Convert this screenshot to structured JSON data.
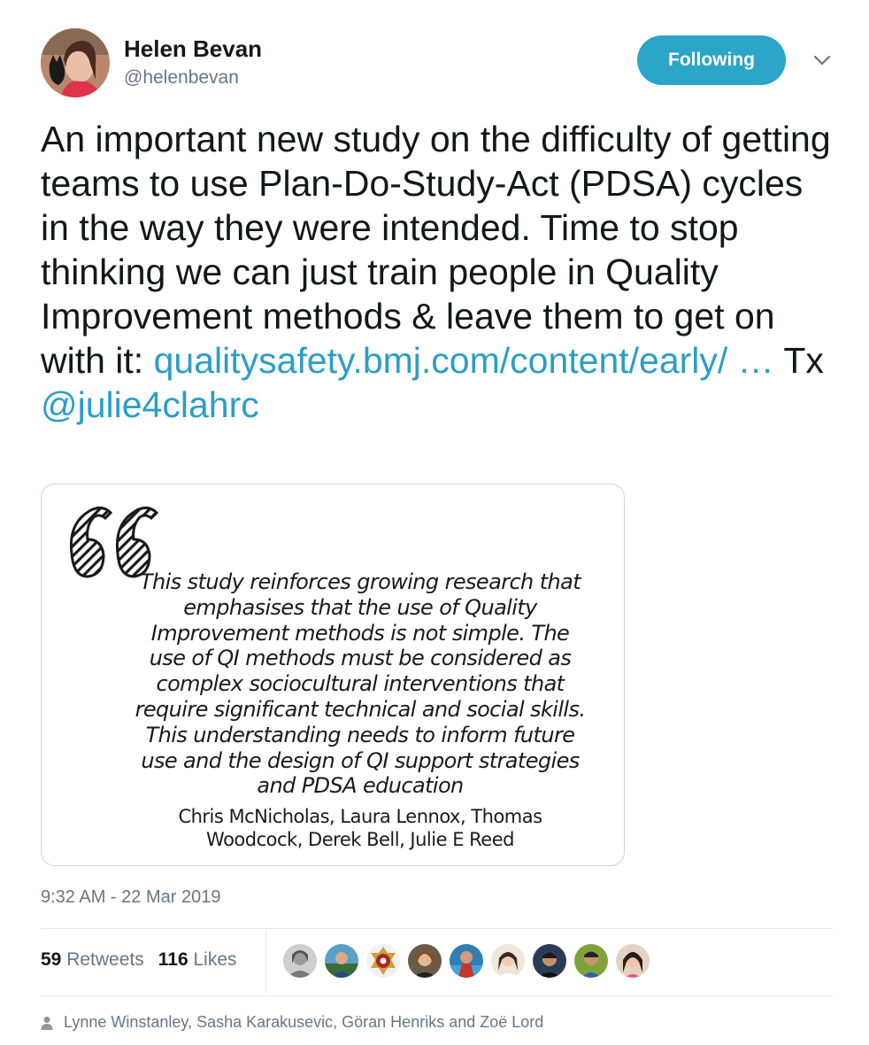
{
  "author": {
    "name": "Helen Bevan",
    "handle": "@helenbevan",
    "avatar_icon": "profile-photo-avatar"
  },
  "follow_button": {
    "label": "Following",
    "color": "#2ba5c8"
  },
  "menu_icon": "chevron-down-icon",
  "tweet": {
    "text_main": "An important new study on the difficulty of getting teams to use Plan-Do-Study-Act (PDSA) cycles in the way they were intended. Time to stop thinking we can just train people in Quality Improvement methods & leave them to get on with it: ",
    "link": "qualitysafety.bmj.com/content/early/ …",
    "text_after_link": " Tx ",
    "mention": "@julie4clahrc",
    "link_color": "#2b9ec6"
  },
  "card": {
    "quote_icon": "quotation-mark-icon",
    "quote": "This study reinforces growing research that emphasises that the use of Quality Improvement methods is not simple. The use of QI methods must be considered as complex sociocultural interventions that require significant technical and social skills. This understanding needs to inform future use and the design of QI support strategies and PDSA education",
    "authors": "Chris McNicholas, Laura Lennox, Thomas Woodcock, Derek Bell, Julie E Reed"
  },
  "timestamp": "9:32 AM - 22 Mar 2019",
  "stats": {
    "retweets_count": "59",
    "retweets_label": "Retweets",
    "likes_count": "116",
    "likes_label": "Likes"
  },
  "likers": [
    {
      "icon": "liker-avatar"
    },
    {
      "icon": "liker-avatar"
    },
    {
      "icon": "liker-avatar-badge"
    },
    {
      "icon": "liker-avatar"
    },
    {
      "icon": "liker-avatar"
    },
    {
      "icon": "liker-avatar"
    },
    {
      "icon": "liker-avatar"
    },
    {
      "icon": "liker-avatar"
    },
    {
      "icon": "liker-avatar"
    }
  ],
  "liked_by": {
    "icon": "person-icon",
    "text": "Lynne Winstanley, Sasha Karakusevic, Göran Henriks and Zoë Lord"
  }
}
